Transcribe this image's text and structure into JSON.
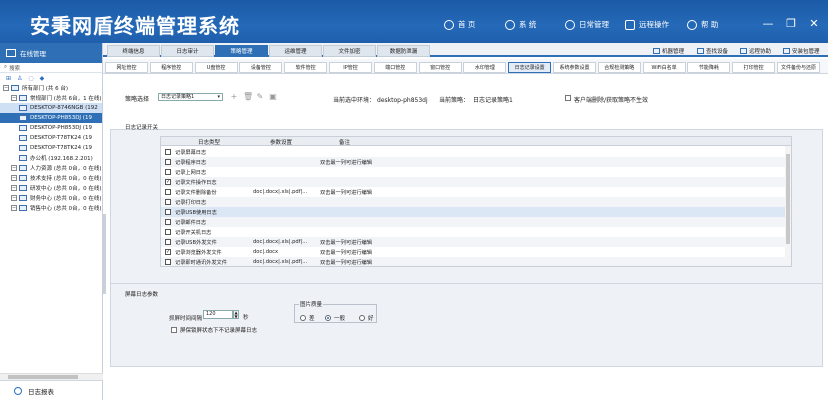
{
  "app": {
    "title": "安秉网盾终端管理系统"
  },
  "topnav": {
    "home": "首 页",
    "system": "系 统",
    "daily_ops": "日常管理",
    "remote_ops": "远程操作",
    "help": "帮 助"
  },
  "window_controls": {
    "minimize": "—",
    "restore": "❐",
    "close": "✕"
  },
  "sidebar": {
    "header": "在线管理",
    "search_placeholder": "搜索",
    "tree": [
      {
        "label": "所有部门 (共 6 台)",
        "level": 0
      },
      {
        "label": "常规部门 (总共 6台，1 在线)",
        "level": 1
      },
      {
        "label": "DESKTOP-8746NGB (192",
        "level": 2
      },
      {
        "label": "DESKTOP-PH853DJ (19",
        "level": 2,
        "selected": true
      },
      {
        "label": "DESKTOP-PH853DJ (19",
        "level": 2
      },
      {
        "label": "DESKTOP-T78TK24 (19",
        "level": 2
      },
      {
        "label": "DESKTOP-T78TK24 (19",
        "level": 2
      },
      {
        "label": "办公机 (192.168.2.201)",
        "level": 2
      },
      {
        "label": "人力资源 (总共 0台，0 在线)",
        "level": 1
      },
      {
        "label": "技术支持 (总共 0台，0 在线)",
        "level": 1
      },
      {
        "label": "研发中心 (总共 0台，0 在线)",
        "level": 1
      },
      {
        "label": "财务中心 (总共 0台，0 在线)",
        "level": 1
      },
      {
        "label": "销售中心 (总共 0台，0 在线)",
        "level": 1
      }
    ],
    "footer": "日志报表"
  },
  "tabs_main": [
    "终端信息",
    "日志审计",
    "策略管理",
    "运维管理",
    "文件加密",
    "数据防泄漏"
  ],
  "tools": [
    "机器管理",
    "查找设备",
    "远程协助",
    "安装包管理"
  ],
  "tabs_sub": [
    "网址管控",
    "程序管控",
    "U盘管控",
    "设备管控",
    "软件管控",
    "IP管控",
    "端口管控",
    "窗口管控",
    "水印管理",
    "日志记录设置",
    "系统参数设置",
    "合规检测策略",
    "WiFi白名单",
    "节能降耗",
    "打印管控",
    "文件备份与还原"
  ],
  "policy": {
    "label": "策略选择",
    "selected": "日志记录策略1",
    "current_env_label": "当前选中环境：",
    "current_env_value": "desktop-ph853dj",
    "current_policy_label": "当前策略：",
    "current_policy_value": "日志记录策略1",
    "customer_cb_label": "客户端删除/获取策略不生效"
  },
  "log_switch": {
    "title": "日志记录开关",
    "columns": [
      "日志类型",
      "参数设置",
      "备注"
    ],
    "rows": [
      {
        "checked": false,
        "type": "记录屏幕日志",
        "param": "",
        "note": ""
      },
      {
        "checked": false,
        "type": "记录程序日志",
        "param": "",
        "note": "双击最一列可进行编辑"
      },
      {
        "checked": false,
        "type": "记录上网日志",
        "param": "",
        "note": ""
      },
      {
        "checked": true,
        "type": "记录文件操作日志",
        "param": "",
        "note": ""
      },
      {
        "checked": false,
        "type": "记录文件删除备份",
        "param": "doc|.docx|.xls|.pdf|...",
        "note": "双击最一列可进行编辑"
      },
      {
        "checked": false,
        "type": "记录打印日志",
        "param": "",
        "note": ""
      },
      {
        "checked": false,
        "type": "记录USB使用日志",
        "param": "",
        "note": ""
      },
      {
        "checked": false,
        "type": "记录邮件日志",
        "param": "",
        "note": ""
      },
      {
        "checked": false,
        "type": "记录开关机日志",
        "param": "",
        "note": ""
      },
      {
        "checked": false,
        "type": "记录USB外发文件",
        "param": "doc|.docx|.xls|.pdf|...",
        "note": "双击最一列可进行编辑"
      },
      {
        "checked": true,
        "type": "记录浏览器外发文件",
        "param": "doc|.docx",
        "note": "双击最一列可进行编辑"
      },
      {
        "checked": false,
        "type": "记录即时通讯外发文件",
        "param": "doc|.docx|.xls|.pdf|...",
        "note": "双击最一列可进行编辑"
      }
    ]
  },
  "screen_params": {
    "title": "屏幕日志参数",
    "interval_label": "抓屏时间间隔",
    "interval_value": "120",
    "interval_unit": "秒",
    "no_shot_label": "屏保锁屏状态下不记录屏幕日志",
    "quality_title": "图片质量",
    "quality_options": [
      "差",
      "一般",
      "好"
    ],
    "quality_selected": 1
  },
  "colors": {
    "header": "#1f5fac",
    "accent": "#2f6fb6",
    "panel": "#eef1f6"
  }
}
